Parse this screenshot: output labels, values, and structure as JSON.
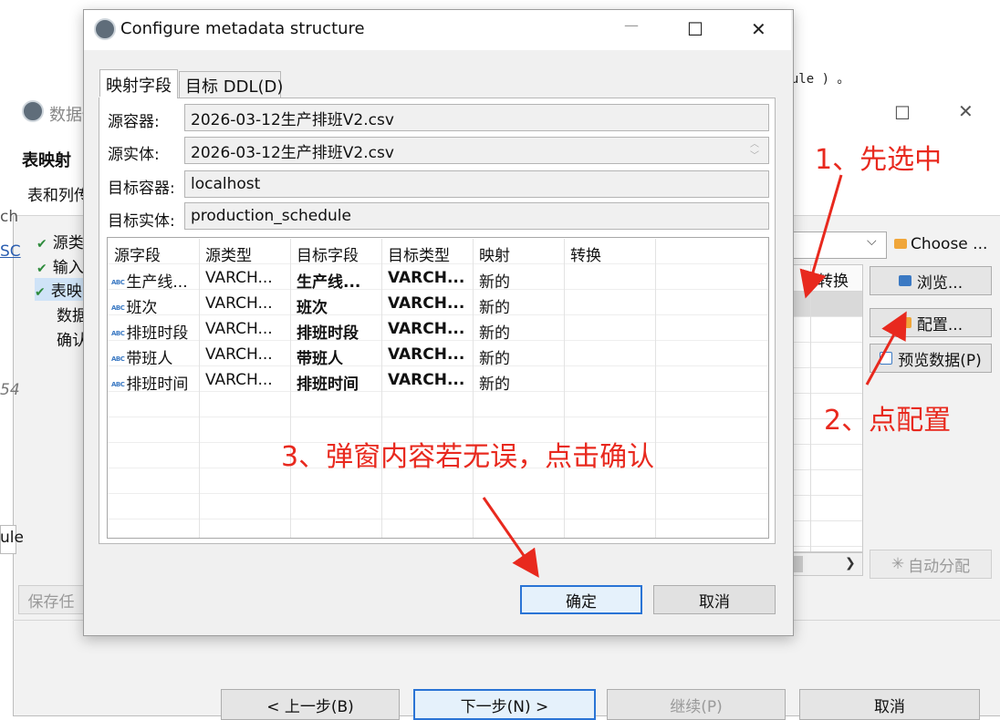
{
  "background": {
    "note_text": "edule ) 。",
    "window_title": "数据传",
    "header_title": "表映射",
    "header_subtitle": "表和列传",
    "left_edge": [
      "ch",
      "SC",
      "54",
      "ule"
    ],
    "steps": [
      {
        "label": "源类",
        "done": true
      },
      {
        "label": "输入",
        "done": true
      },
      {
        "label": "表映",
        "done": true,
        "selected": true
      },
      {
        "label": "数据",
        "done": false
      },
      {
        "label": "确认",
        "done": false
      }
    ],
    "choose_label": "Choose ...",
    "grid_header": "转换",
    "buttons": {
      "browse": "浏览...",
      "configure": "配置...",
      "preview": "预览数据(P)",
      "auto_assign": "自动分配",
      "save": "保存任"
    },
    "bottom_buttons": {
      "back": "< 上一步(B)",
      "next": "下一步(N) >",
      "continue": "继续(P)",
      "cancel": "取消"
    }
  },
  "dialog": {
    "title": "Configure metadata structure",
    "tabs": [
      {
        "label": "映射字段",
        "active": true
      },
      {
        "label": "目标 DDL(D)",
        "active": false
      }
    ],
    "fields": {
      "source_container": {
        "label": "源容器:",
        "value": "2026-03-12生产排班V2.csv"
      },
      "source_entity": {
        "label": "源实体:",
        "value": "2026-03-12生产排班V2.csv"
      },
      "target_container": {
        "label": "目标容器:",
        "value": "localhost"
      },
      "target_entity": {
        "label": "目标实体:",
        "value": "production_schedule"
      }
    },
    "table": {
      "columns": [
        "源字段",
        "源类型",
        "目标字段",
        "目标类型",
        "映射",
        "转换"
      ],
      "rows": [
        {
          "source": "生产线...",
          "source_type": "VARCH...",
          "target": "生产线...",
          "target_type": "VARCH...",
          "mapping": "新的",
          "transform": ""
        },
        {
          "source": "班次",
          "source_type": "VARCH...",
          "target": "班次",
          "target_type": "VARCH...",
          "mapping": "新的",
          "transform": ""
        },
        {
          "source": "排班时段",
          "source_type": "VARCH...",
          "target": "排班时段",
          "target_type": "VARCH...",
          "mapping": "新的",
          "transform": ""
        },
        {
          "source": "带班人",
          "source_type": "VARCH...",
          "target": "带班人",
          "target_type": "VARCH...",
          "mapping": "新的",
          "transform": ""
        },
        {
          "source": "排班时间",
          "source_type": "VARCH...",
          "target": "排班时间",
          "target_type": "VARCH...",
          "mapping": "新的",
          "transform": ""
        }
      ]
    },
    "ok_label": "确定",
    "cancel_label": "取消"
  },
  "annotations": {
    "step1": "1、先选中",
    "step2": "2、点配置",
    "step3": "3、弹窗内容若无误，点击确认",
    "color": "#e8291e"
  }
}
